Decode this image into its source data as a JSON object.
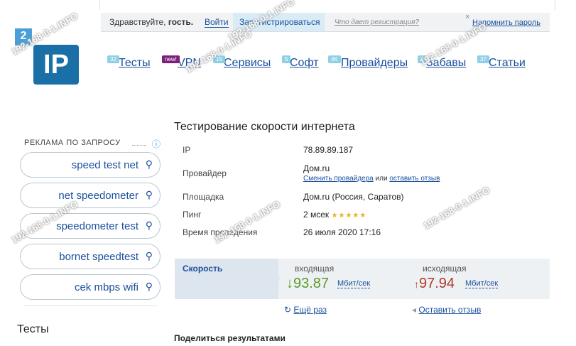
{
  "auth": {
    "greeting_prefix": "Здравствуйте, ",
    "greeting_user": "гость.",
    "login": "Войти",
    "register": "Зарегистрироваться",
    "why_register": "Что дает регистрация?",
    "remind_password": "Напомнить пароль",
    "close": "×"
  },
  "logo": {
    "text": "IP",
    "badge": "2"
  },
  "nav": [
    {
      "label": "Тесты",
      "badge": "32"
    },
    {
      "label": "VPN",
      "badge": "new!"
    },
    {
      "label": "Сервисы",
      "badge": "15"
    },
    {
      "label": "Софт",
      "badge": "5"
    },
    {
      "label": "Провайдеры",
      "badge": "4K"
    },
    {
      "label": "Забавы",
      "badge": "9"
    },
    {
      "label": "Статьи",
      "badge": "37"
    }
  ],
  "sidebar": {
    "ad_title": "РЕКЛАМА ПО ЗАПРОСУ",
    "ad_info": "ⓘ",
    "queries": [
      "speed test net",
      "net speedometer",
      "speedometer test",
      "bornet speedtest",
      "cek mbps wifi"
    ],
    "tests_heading": "Тесты"
  },
  "main": {
    "title": "Тестирование скорости интернета",
    "rows": {
      "ip_label": "IP",
      "ip_value": "78.89.89.187",
      "provider_label": "Провайдер",
      "provider_value": "Дом.ru",
      "change_provider": "Сменить провайдера",
      "or": " или ",
      "leave_review": "оставить отзыв",
      "platform_label": "Площадка",
      "platform_value": "Дом.ru (Россия, Саратов)",
      "ping_label": "Пинг",
      "ping_value": "2 мсек ",
      "ping_stars": "★★★★★",
      "time_label": "Время проведения",
      "time_value": "26 июля 2020 17:16"
    },
    "speed": {
      "label": "Скорость",
      "in_label": "входящая",
      "in_arrow": "↓",
      "in_value": "93.87",
      "in_unit": "Мбит/сек",
      "out_label": "исходящая",
      "out_arrow": "↑",
      "out_value": "97.94",
      "out_unit": "Мбит/сек"
    },
    "again": "Ещё раз",
    "again_icon": "↻",
    "feedback": "Оставить отзыв",
    "feedback_icon": "◂",
    "share": "Поделиться результатами"
  },
  "watermark": "192-168-0-1.INFO",
  "colors": {
    "accent": "#1a4f9c",
    "in": "#5a9a2a",
    "out": "#b0392a"
  }
}
